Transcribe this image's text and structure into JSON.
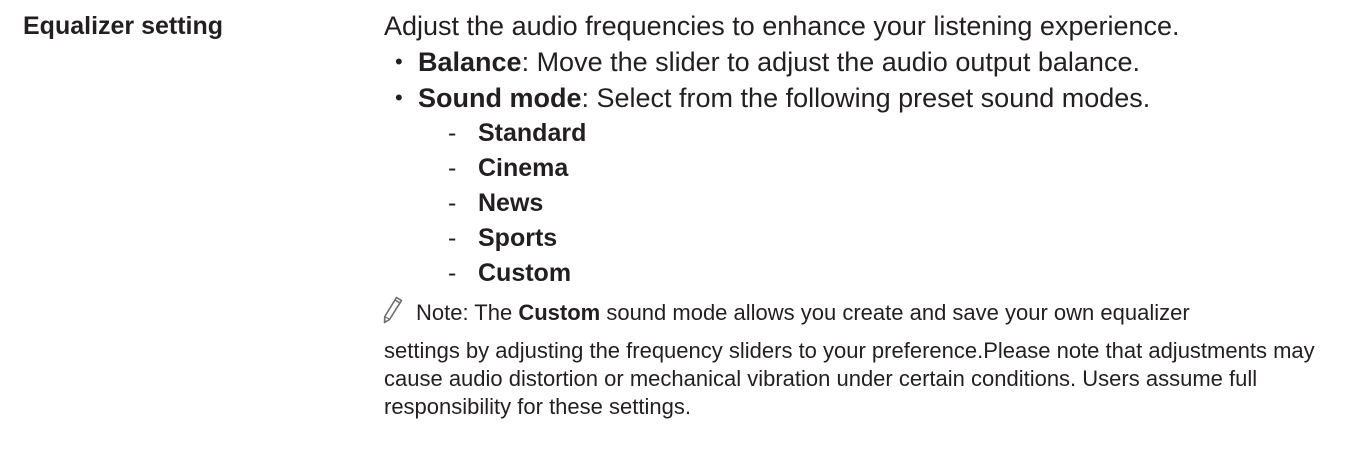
{
  "setting": {
    "name": "Equalizer setting",
    "intro": "Adjust the audio frequencies to enhance your listening experience.",
    "bullets": [
      {
        "term": "Balance",
        "text": ": Move the slider to adjust the audio output balance."
      },
      {
        "term": "Sound mode",
        "text": ": Select from the following preset sound modes."
      }
    ],
    "sound_modes": [
      "Standard",
      "Cinema",
      "News",
      "Sports",
      "Custom"
    ],
    "bullet_glyph": "•",
    "dash_glyph": "-",
    "note": {
      "icon": "pencil-icon",
      "prefix": "Note: The ",
      "term": "Custom",
      "line1_rest": " sound mode allows you create and save your own equalizer",
      "rest": "settings by adjusting the frequency sliders to your preference.Please note that adjustments may cause audio distortion or mechanical vibration under certain conditions. Users assume full responsibility for these settings."
    }
  }
}
